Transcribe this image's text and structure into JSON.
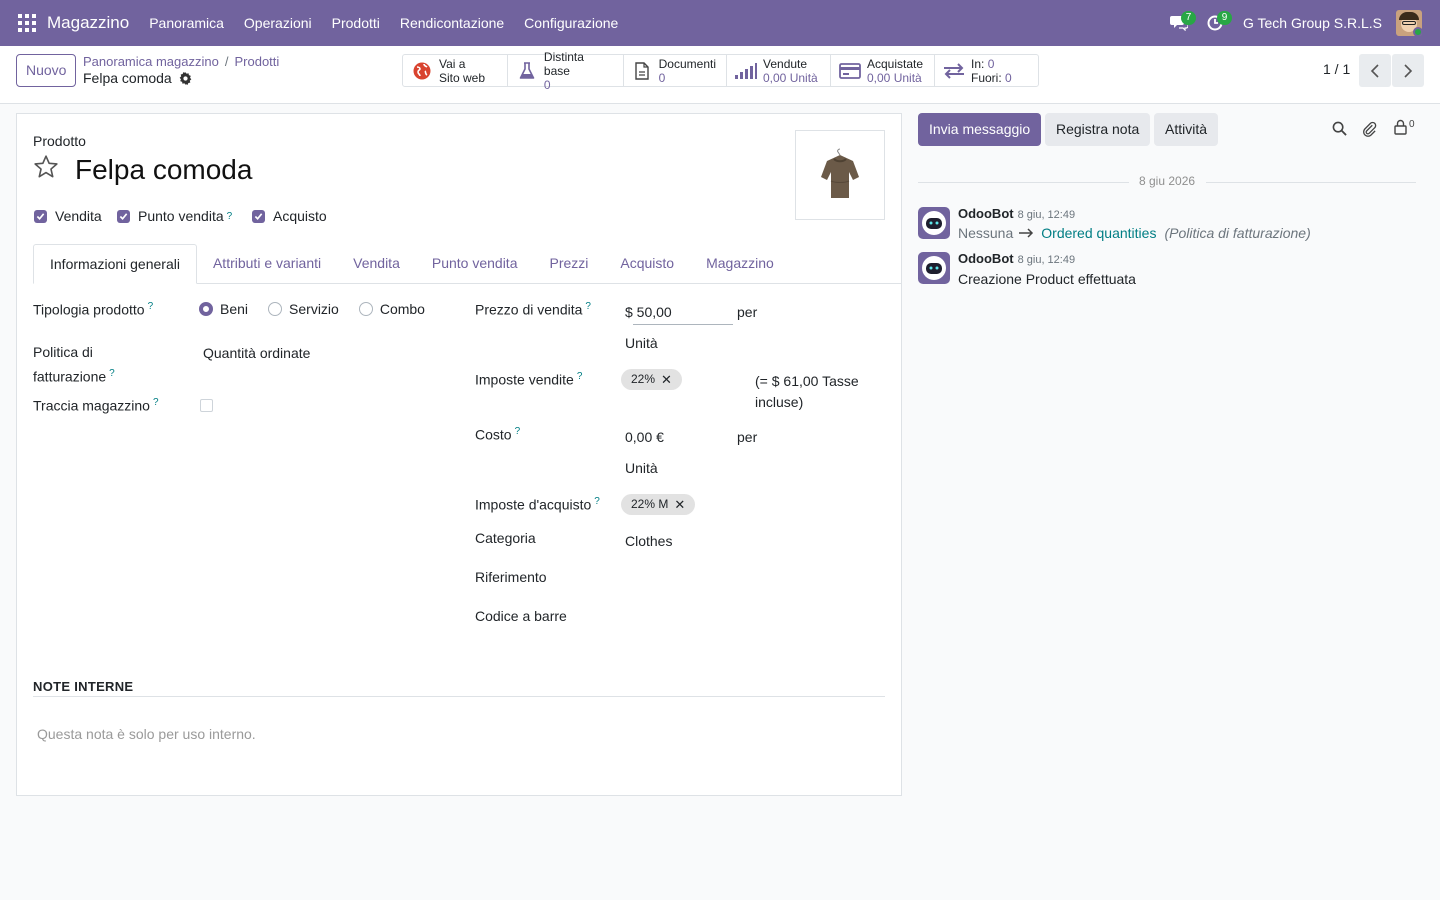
{
  "navbar": {
    "brand": "Magazzino",
    "menu": [
      "Panoramica",
      "Operazioni",
      "Prodotti",
      "Rendicontazione",
      "Configurazione"
    ],
    "messages_count": "7",
    "activities_count": "9",
    "company": "G Tech Group S.R.L.S"
  },
  "control": {
    "new_button": "Nuovo",
    "breadcrumb": [
      "Panoramica magazzino",
      "Prodotti"
    ],
    "record_title": "Felpa comoda",
    "stats": [
      {
        "line1": "Vai a",
        "line2": "Sito web",
        "value": ""
      },
      {
        "line1": "Distinta base",
        "line2": "",
        "value": "0"
      },
      {
        "line1": "Documenti",
        "line2": "",
        "value": "0"
      },
      {
        "line1": "Vendute",
        "line2": "",
        "value": "0,00 Unità"
      },
      {
        "line1": "Acquistate",
        "line2": "",
        "value": "0,00 Unità"
      }
    ],
    "in_label": "In:",
    "in_value": "0",
    "out_label": "Fuori:",
    "out_value": "0",
    "pager": "1 / 1"
  },
  "form": {
    "product_label": "Prodotto",
    "product_name": "Felpa comoda",
    "checks": [
      {
        "label": "Vendita",
        "checked": true,
        "help": ""
      },
      {
        "label": "Punto vendita",
        "checked": true,
        "help": "?"
      },
      {
        "label": "Acquisto",
        "checked": true,
        "help": ""
      }
    ],
    "tabs": [
      "Informazioni generali",
      "Attributi e varianti",
      "Vendita",
      "Punto vendita",
      "Prezzi",
      "Acquisto",
      "Magazzino"
    ],
    "active_tab": "Informazioni generali",
    "left": {
      "type_label": "Tipologia prodotto",
      "type_options": [
        "Beni",
        "Servizio",
        "Combo"
      ],
      "type_selected": "Beni",
      "invoice_policy_label_1": "Politica di",
      "invoice_policy_label_2": "fatturazione",
      "invoice_policy_value": "Quantità ordinate",
      "track_label": "Traccia magazzino",
      "track_checked": false
    },
    "right": {
      "sale_price_label": "Prezzo di vendita",
      "sale_price_value": "$ 50,00",
      "per": "per",
      "uom": "Unità",
      "sale_taxes_label": "Imposte vendite",
      "sale_tax_tag": "22%",
      "taxes_included_1": "(= $ 61,00 Tasse",
      "taxes_included_2": "incluse)",
      "cost_label": "Costo",
      "cost_value": "0,00 €",
      "purchase_taxes_label": "Imposte d'acquisto",
      "purchase_tax_tag": "22% M",
      "category_label": "Categoria",
      "category_value": "Clothes",
      "reference_label": "Riferimento",
      "barcode_label": "Codice a barre"
    },
    "notes_title": "NOTE INTERNE",
    "notes_placeholder": "Questa nota è solo per uso interno."
  },
  "chatter": {
    "send_message": "Invia messaggio",
    "log_note": "Registra nota",
    "activities": "Attività",
    "followers_count": "0",
    "date_separator": "8 giu 2026",
    "messages": [
      {
        "author": "OdooBot",
        "time": "8 giu, 12:49",
        "old_value": "Nessuna",
        "new_value": "Ordered quantities",
        "field": "(Politica di fatturazione)"
      },
      {
        "author": "OdooBot",
        "time": "8 giu, 12:49",
        "body": "Creazione Product effettuata"
      }
    ]
  },
  "colors": {
    "brand": "#71639e",
    "badge": "#28a745",
    "link_teal": "#017e84"
  }
}
